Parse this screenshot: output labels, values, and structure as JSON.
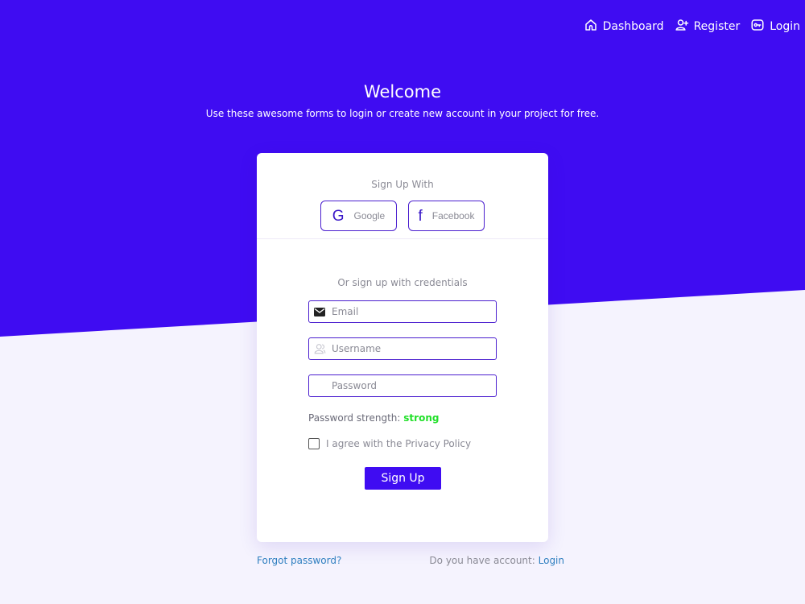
{
  "colors": {
    "primary": "#3f0cf2",
    "page_background": "#f5f3fe",
    "link": "#2f7fc0",
    "strength_strong": "#22e02a"
  },
  "nav": {
    "items": [
      {
        "label": "Dashboard",
        "icon": "home-icon"
      },
      {
        "label": "Register",
        "icon": "user-plus-icon"
      },
      {
        "label": "Login",
        "icon": "key-icon"
      }
    ]
  },
  "hero": {
    "title": "Welcome",
    "subtitle": "Use these awesome forms to login or create new account in your project for free."
  },
  "card": {
    "signup_with": "Sign Up With",
    "social": [
      {
        "label": "Google",
        "glyph": "G",
        "icon": "google-icon"
      },
      {
        "label": "Facebook",
        "glyph": "f",
        "icon": "facebook-icon"
      }
    ],
    "credentials_label": "Or sign up with credentials",
    "fields": {
      "email": {
        "placeholder": "Email",
        "value": "",
        "icon": "envelope-icon"
      },
      "username": {
        "placeholder": "Username",
        "value": "",
        "icon": "user-icon"
      },
      "password": {
        "placeholder": "Password",
        "value": ""
      }
    },
    "password_strength": {
      "label": "Password strength:",
      "value": "strong"
    },
    "agree_label": "I agree with the Privacy Policy",
    "agree_checked": false,
    "submit_label": "Sign Up"
  },
  "footer": {
    "forgot_password": "Forgot password?",
    "have_account": "Do you have account:",
    "login_link": "Login"
  }
}
